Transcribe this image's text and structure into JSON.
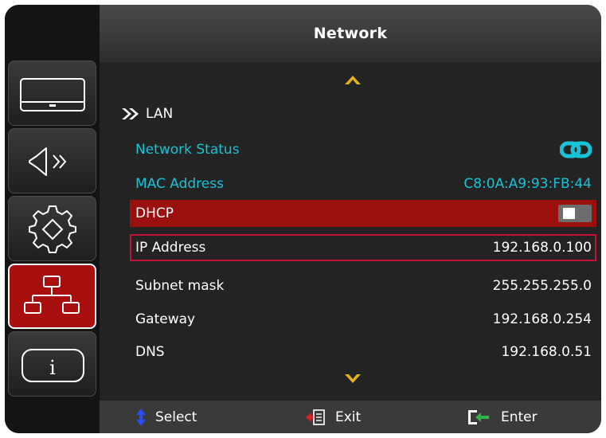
{
  "header": {
    "title": "Network"
  },
  "sidebar": {
    "tabs": [
      {
        "name": "display-tab",
        "icon": "display-icon",
        "active": false
      },
      {
        "name": "audio-tab",
        "icon": "speaker-icon",
        "active": false
      },
      {
        "name": "setup-tab",
        "icon": "gear-icon",
        "active": false
      },
      {
        "name": "network-tab",
        "icon": "network-icon",
        "active": true
      },
      {
        "name": "info-tab",
        "icon": "info-icon",
        "active": false
      }
    ]
  },
  "lan": {
    "label": "LAN",
    "icon": "double-chevron-right-icon"
  },
  "rows": [
    {
      "label": "Network Status",
      "value_icon": "link-icon"
    },
    {
      "label": "MAC Address",
      "value": "C8:0A:A9:93:FB:44"
    },
    {
      "label": "DHCP",
      "toggle": "off"
    },
    {
      "label": "IP Address",
      "value": "192.168.0.100"
    },
    {
      "label": "Subnet mask",
      "value": "255.255.255.0"
    },
    {
      "label": "Gateway",
      "value": "192.168.0.254"
    },
    {
      "label": "DNS",
      "value": "192.168.0.51"
    }
  ],
  "footer": {
    "select_label": "Select",
    "exit_label": "Exit",
    "enter_label": "Enter"
  },
  "colors": {
    "accent_cyan": "#19c3d6",
    "selected_red": "#9c0f0f",
    "arrow_gold": "#e7b21a",
    "focus_border": "#c4123a"
  }
}
